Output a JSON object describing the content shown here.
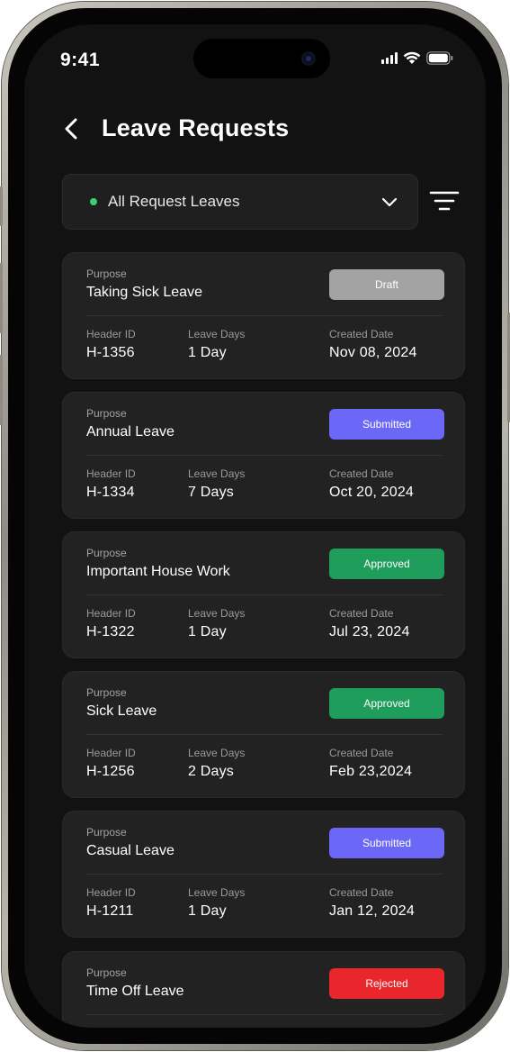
{
  "status_bar": {
    "time": "9:41"
  },
  "header": {
    "title": "Leave Requests"
  },
  "filter": {
    "selected": "All Request Leaves",
    "dot_color": "#3ecf6e"
  },
  "labels": {
    "purpose": "Purpose",
    "header_id": "Header ID",
    "leave_days": "Leave Days",
    "created_date": "Created Date"
  },
  "status_colors": {
    "Draft": "#a3a3a3",
    "Submitted": "#6b68f7",
    "Approved": "#1f9d5b",
    "Rejected": "#e8262b"
  },
  "requests": [
    {
      "purpose": "Taking Sick Leave",
      "status": "Draft",
      "header_id": "H-1356",
      "leave_days": "1 Day",
      "created_date": "Nov 08, 2024"
    },
    {
      "purpose": "Annual Leave",
      "status": "Submitted",
      "header_id": "H-1334",
      "leave_days": "7 Days",
      "created_date": "Oct 20, 2024"
    },
    {
      "purpose": "Important House Work",
      "status": "Approved",
      "header_id": "H-1322",
      "leave_days": "1 Day",
      "created_date": "Jul 23, 2024"
    },
    {
      "purpose": "Sick Leave",
      "status": "Approved",
      "header_id": "H-1256",
      "leave_days": "2 Days",
      "created_date": "Feb 23,2024"
    },
    {
      "purpose": "Casual Leave",
      "status": "Submitted",
      "header_id": "H-1211",
      "leave_days": "1 Day",
      "created_date": "Jan 12, 2024"
    },
    {
      "purpose": "Time Off Leave",
      "status": "Rejected",
      "header_id": "",
      "leave_days": "",
      "created_date": ""
    }
  ]
}
